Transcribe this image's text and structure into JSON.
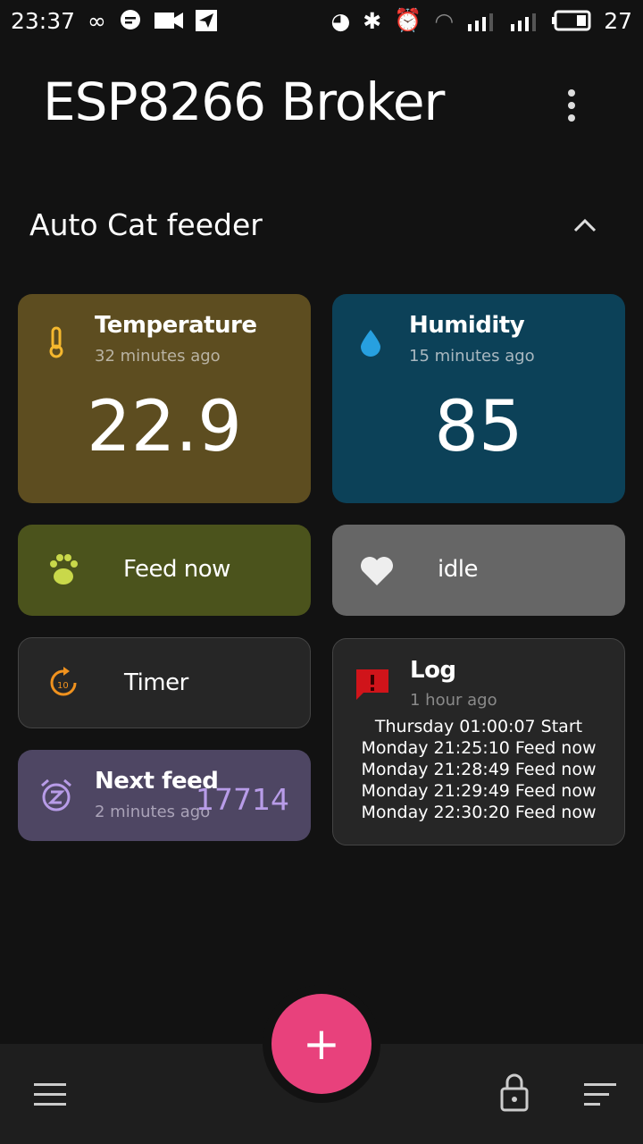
{
  "status_bar": {
    "time": "23:37",
    "battery": "27",
    "icons": [
      "infinity-icon",
      "chat-icon",
      "video-icon",
      "telegram-icon",
      "data-saver-icon",
      "bluetooth-icon",
      "alarm-icon",
      "wifi-icon",
      "signal-3g-icon",
      "signal-icon",
      "battery-icon"
    ]
  },
  "header": {
    "title": "ESP8266 Broker",
    "menu_icon": "more-vertical-icon"
  },
  "section": {
    "title": "Auto Cat feeder",
    "collapse_icon": "chevron-up-icon"
  },
  "tiles": {
    "temperature": {
      "title": "Temperature",
      "subtitle": "32 minutes ago",
      "value": "22.9",
      "color": "#5d4d20",
      "icon": "thermometer-icon"
    },
    "humidity": {
      "title": "Humidity",
      "subtitle": "15 minutes ago",
      "value": "85",
      "color": "#0c4158",
      "icon": "water-drop-icon"
    },
    "feed": {
      "title": "Feed now",
      "color": "#4b531c",
      "icon": "paw-icon"
    },
    "status": {
      "title": "idle",
      "color": "#666666",
      "icon": "heart-icon"
    },
    "timer": {
      "title": "Timer",
      "color": "#262626",
      "icon": "timer-10-icon"
    },
    "next_feed": {
      "title": "Next feed",
      "subtitle": "2 minutes ago",
      "value": "17714",
      "color": "#4e4663",
      "icon": "snooze-alarm-icon"
    },
    "log": {
      "title": "Log",
      "subtitle": "1 hour ago",
      "color": "#262626",
      "icon": "alert-message-icon",
      "lines": [
        "Thursday 01:00:07 Start",
        "Monday 21:25:10 Feed now",
        "Monday 21:28:49 Feed now",
        "Monday 21:29:49 Feed now",
        "Monday 22:30:20 Feed now"
      ]
    }
  },
  "fab": {
    "label": "+",
    "color": "#e8417c"
  },
  "bottom_bar": {
    "icons": [
      "hamburger-menu-icon",
      "lock-icon",
      "sort-icon"
    ]
  }
}
